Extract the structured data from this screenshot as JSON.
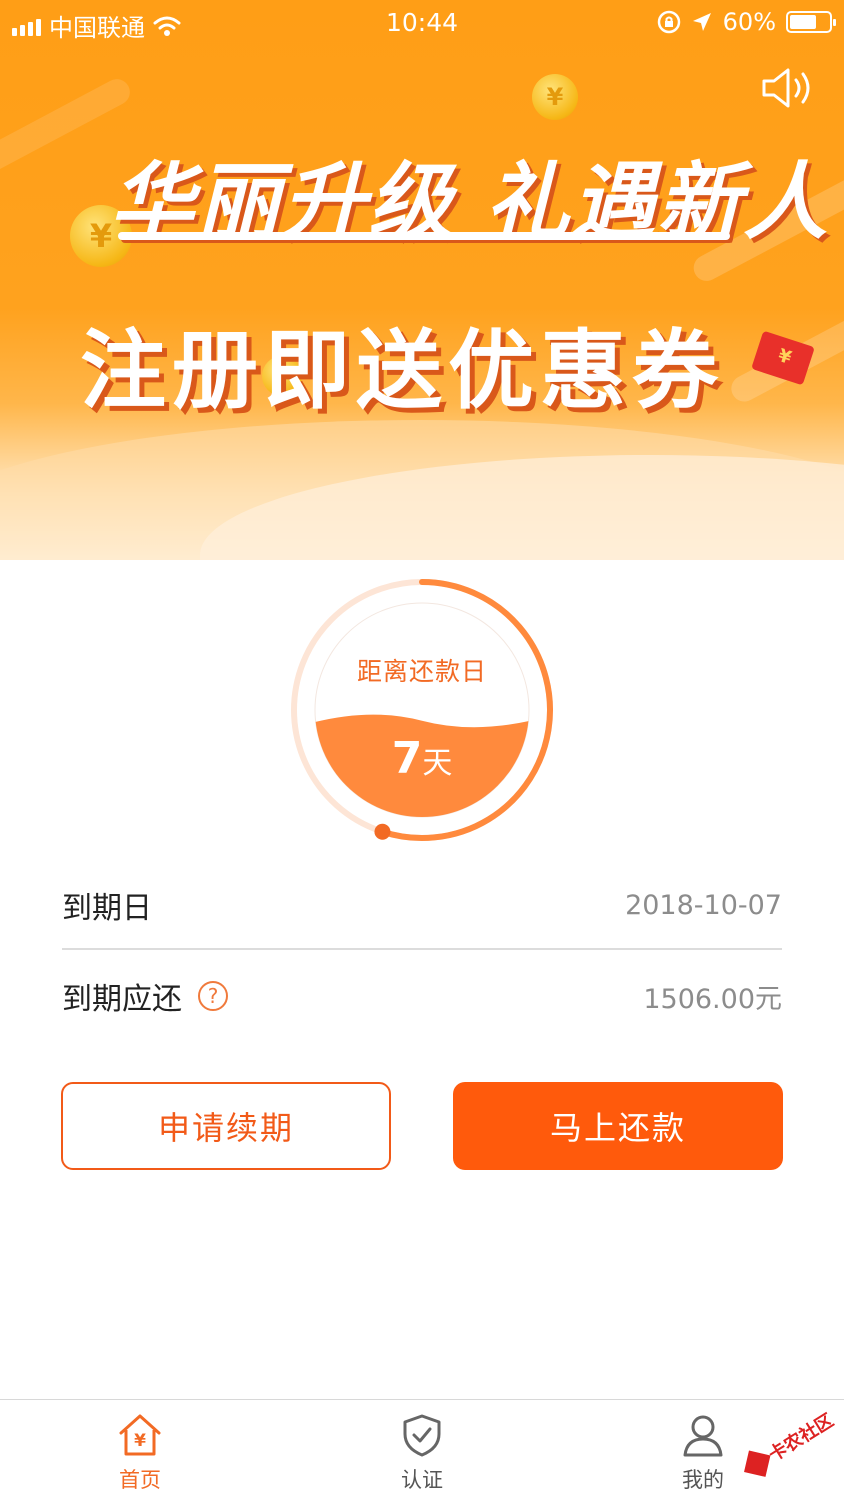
{
  "status_bar": {
    "carrier": "中国联通",
    "time": "10:44",
    "battery": "60%"
  },
  "banner": {
    "headline_line1": "华丽升级 礼遇新人",
    "headline_line2": "注册即送优惠券",
    "coin_symbol": "¥"
  },
  "countdown": {
    "label": "距离还款日",
    "days": "7",
    "unit": "天",
    "progress": 0.45
  },
  "info": {
    "due_date_label": "到期日",
    "due_date_value": "2018-10-07",
    "due_amount_label": "到期应还",
    "due_amount_value": "1506.00元",
    "help_symbol": "?"
  },
  "actions": {
    "extend_label": "申请续期",
    "repay_label": "马上还款"
  },
  "tabbar": {
    "home_label": "首页",
    "verify_label": "认证",
    "mine_label": "我的",
    "home_icon_symbol": "¥"
  },
  "watermark": {
    "text": "卡农社区"
  },
  "colors": {
    "accent": "#ff5a0c",
    "banner": "#ffa21e",
    "gauge_fill": "#ff8a3d"
  }
}
